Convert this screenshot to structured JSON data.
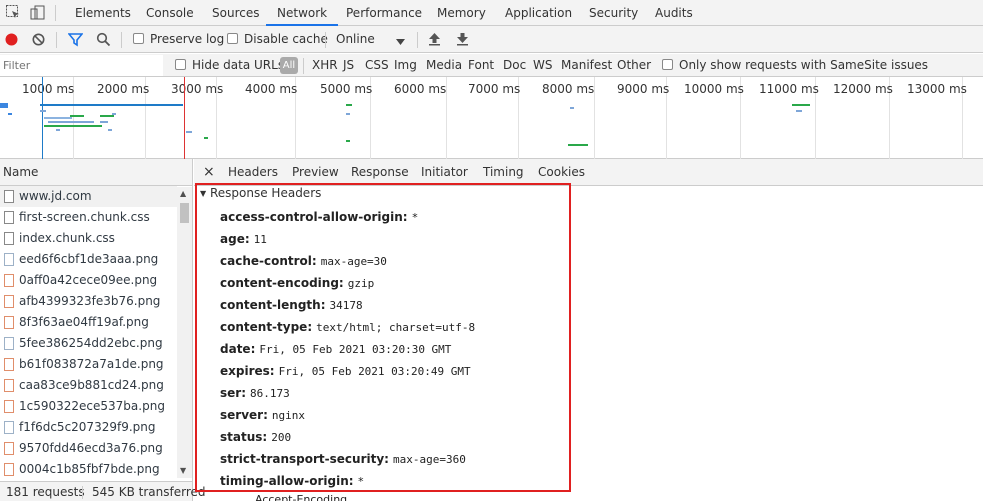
{
  "tabs": [
    "Elements",
    "Console",
    "Sources",
    "Network",
    "Performance",
    "Memory",
    "Application",
    "Security",
    "Audits"
  ],
  "active_tab": "Network",
  "toolbar": {
    "preserve_log": "Preserve log",
    "disable_cache": "Disable cache",
    "throttle": "Online"
  },
  "filter": {
    "placeholder": "Filter",
    "hide_data_urls": "Hide data URLs",
    "all": "All",
    "types": [
      "XHR",
      "JS",
      "CSS",
      "Img",
      "Media",
      "Font",
      "Doc",
      "WS",
      "Manifest",
      "Other"
    ],
    "samesite": "Only show requests with SameSite issues"
  },
  "timeline_ticks": [
    "1000 ms",
    "2000 ms",
    "3000 ms",
    "4000 ms",
    "5000 ms",
    "6000 ms",
    "7000 ms",
    "8000 ms",
    "9000 ms",
    "10000 ms",
    "11000 ms",
    "12000 ms",
    "13000 ms"
  ],
  "name_header": "Name",
  "files": [
    {
      "name": "www.jd.com",
      "kind": "doc"
    },
    {
      "name": "first-screen.chunk.css",
      "kind": "doc"
    },
    {
      "name": "index.chunk.css",
      "kind": "doc"
    },
    {
      "name": "eed6f6cbf1de3aaa.png",
      "kind": "img"
    },
    {
      "name": "0aff0a42cece09ee.png",
      "kind": "img2"
    },
    {
      "name": "afb4399323fe3b76.png",
      "kind": "img2"
    },
    {
      "name": "8f3f63ae04ff19af.png",
      "kind": "img2"
    },
    {
      "name": "5fee386254dd2ebc.png",
      "kind": "img"
    },
    {
      "name": "b61f083872a7a1de.png",
      "kind": "img2"
    },
    {
      "name": "caa83ce9b881cd24.png",
      "kind": "img2"
    },
    {
      "name": "1c590322ece537ba.png",
      "kind": "img2"
    },
    {
      "name": "f1f6dc5c207329f9.png",
      "kind": "img"
    },
    {
      "name": "9570fdd46ecd3a76.png",
      "kind": "img2"
    },
    {
      "name": "0004c1b85fbf7bde.png",
      "kind": "img2"
    }
  ],
  "status": {
    "requests": "181 requests",
    "transferred": "545 KB transferred"
  },
  "detail_tabs": [
    "Headers",
    "Preview",
    "Response",
    "Initiator",
    "Timing",
    "Cookies"
  ],
  "response_headers_title": "Response Headers",
  "headers": [
    {
      "k": "access-control-allow-origin:",
      "v": "*"
    },
    {
      "k": "age:",
      "v": "11"
    },
    {
      "k": "cache-control:",
      "v": "max-age=30"
    },
    {
      "k": "content-encoding:",
      "v": "gzip"
    },
    {
      "k": "content-length:",
      "v": "34178"
    },
    {
      "k": "content-type:",
      "v": "text/html; charset=utf-8"
    },
    {
      "k": "date:",
      "v": "Fri, 05 Feb 2021 03:20:30 GMT"
    },
    {
      "k": "expires:",
      "v": "Fri, 05 Feb 2021 03:20:49 GMT"
    },
    {
      "k": "ser:",
      "v": "86.173"
    },
    {
      "k": "server:",
      "v": "nginx"
    },
    {
      "k": "status:",
      "v": "200"
    },
    {
      "k": "strict-transport-security:",
      "v": "max-age=360"
    },
    {
      "k": "timing-allow-origin:",
      "v": "*"
    }
  ],
  "next_header_partial": "Accept-Encoding"
}
